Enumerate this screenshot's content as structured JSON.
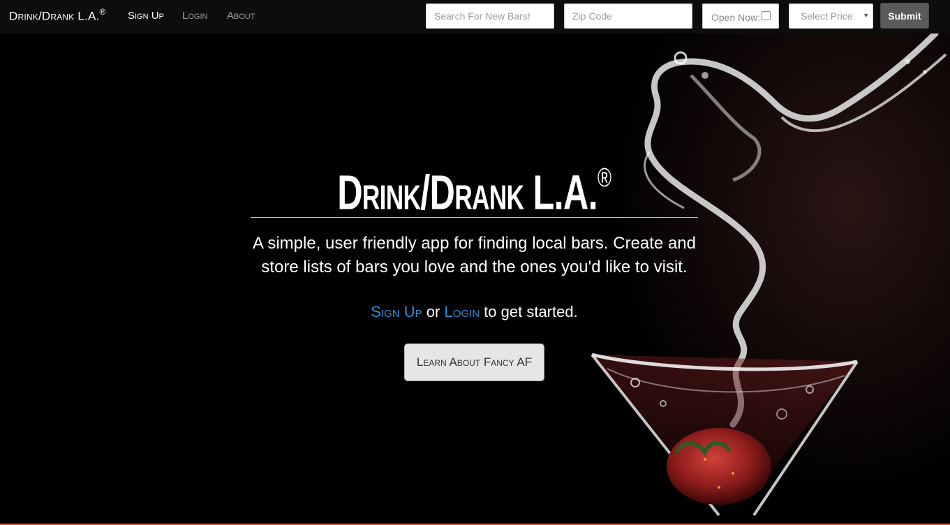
{
  "navbar": {
    "brand": "Drink/Drank L.A.",
    "brand_mark": "®",
    "links": {
      "signup": "Sign Up",
      "login": "Login",
      "about": "About"
    },
    "search": {
      "placeholder": "Search For New Bars!",
      "value": ""
    },
    "zip": {
      "placeholder": "Zip Code",
      "value": ""
    },
    "open_now": {
      "label": "Open Now:",
      "checked": false
    },
    "price_select": {
      "selected": "Select Price"
    },
    "submit_label": "Submit"
  },
  "hero": {
    "title": "Drink/Drank L.A.",
    "title_mark": "®",
    "description": "A simple, user friendly app for finding local bars. Create and store lists of bars you love and the ones you'd like to visit.",
    "cta": {
      "signup_link": "Sign Up",
      "or_text": "or",
      "login_link": "Login",
      "suffix": "to get started."
    },
    "learn_button": "Learn About Fancy AF"
  },
  "colors": {
    "navbar_bg": "#0d0d0d",
    "page_bg": "#000000",
    "link_accent": "#2f8fd8",
    "submit_bg": "#5a5a5a",
    "bottom_accent": "#e8533a"
  },
  "icons": {
    "select_caret": "caret-down-icon",
    "checkbox": "checkbox-icon",
    "hero_image": "martini-glass-splash-image"
  }
}
